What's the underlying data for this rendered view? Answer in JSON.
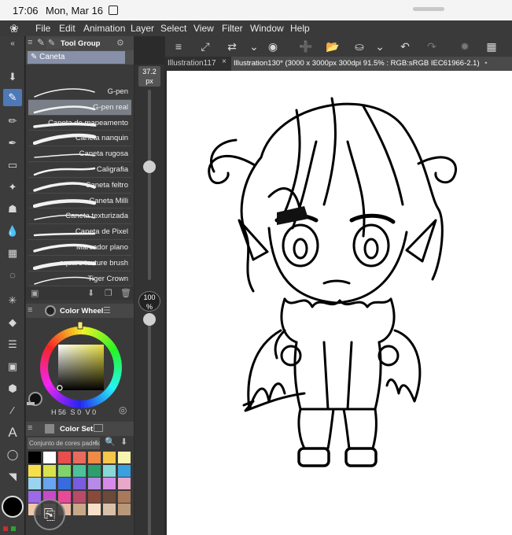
{
  "status_bar": {
    "time": "17:06",
    "date": "Mon, Mar 16"
  },
  "menu": {
    "items": [
      "File",
      "Edit",
      "Animation",
      "Layer",
      "Select",
      "View",
      "Filter",
      "Window",
      "Help"
    ]
  },
  "tabs": [
    {
      "label": "Illustration117",
      "close": "×"
    },
    {
      "label": "Illustration130* (3000 x 3000px 300dpi 91.5% : RGB:sRGB IEC61966-2.1)"
    }
  ],
  "tool_panel": {
    "tab_label": "Tool Group",
    "group_name": "Caneta",
    "brushes": [
      {
        "label": "G-pen"
      },
      {
        "label": "G-pen real",
        "selected": true
      },
      {
        "label": "Caneta de mapeamento"
      },
      {
        "label": "Caneta nanquin"
      },
      {
        "label": "Caneta rugosa"
      },
      {
        "label": "Caligrafia"
      },
      {
        "label": "Caneta feltro"
      },
      {
        "label": "Caneta Milli"
      },
      {
        "label": "Caneta texturizada"
      },
      {
        "label": "Caneta de Pixel"
      },
      {
        "label": "Marcador plano"
      },
      {
        "label": "square texture brush"
      },
      {
        "label": "Tiger Crown"
      }
    ]
  },
  "brush_size": {
    "value": "37.2",
    "unit": "px",
    "level": 0.72
  },
  "opacity": {
    "value": "100",
    "unit": "%",
    "level": 1.0
  },
  "color_wheel": {
    "title": "Color Wheel",
    "h": "56",
    "s": "0",
    "v": "0",
    "main_color": "#111111",
    "square_hue": "#e8e040"
  },
  "color_set": {
    "title": "Color Set",
    "palette_name": "Conjunto de cores padrão",
    "swatches": [
      "#000000",
      "#ffffff",
      "#e84e4e",
      "#e96a5e",
      "#f08a46",
      "#f6c64a",
      "#f7f3b0",
      "#f5e04b",
      "#d9e24a",
      "#7fd36a",
      "#4cc29b",
      "#2f9e6f",
      "#8ad7d7",
      "#3aa0e0",
      "#9ad3f0",
      "#6aa3f0",
      "#3a6ae0",
      "#7a5ce0",
      "#b88ae8",
      "#d88ae8",
      "#e8a8c8",
      "#9a6ae8",
      "#c84ac8",
      "#e84a9a",
      "#b84a6a",
      "#8a4a3a",
      "#6a4a3a",
      "#a87a5a",
      "#f0c8a8",
      "#f0d8b8",
      "#e8b8a0",
      "#c8a888",
      "#f8e0c8",
      "#d8c0a8",
      "#b89878"
    ]
  }
}
